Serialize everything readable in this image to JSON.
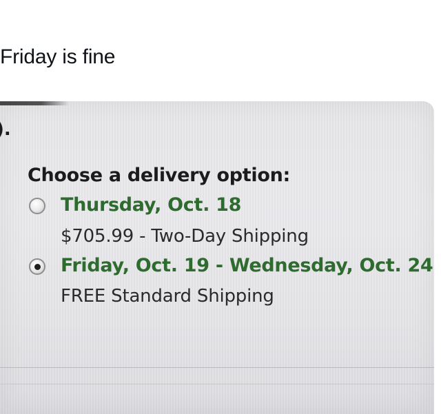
{
  "post": {
    "text": "Friday is fine"
  },
  "photo": {
    "corner_fragment": ").",
    "heading": "Choose a delivery option:",
    "options": [
      {
        "date": "Thursday, Oct. 18",
        "shipping": "$705.99 - Two-Day Shipping",
        "selected": false
      },
      {
        "date": "Friday, Oct. 19 - Wednesday, Oct. 24",
        "shipping": "FREE Standard Shipping",
        "selected": true
      }
    ]
  },
  "colors": {
    "date_green": "#2e6b2f",
    "text_dark": "#1b1b1b",
    "photo_bg": "#e6e6e8"
  }
}
